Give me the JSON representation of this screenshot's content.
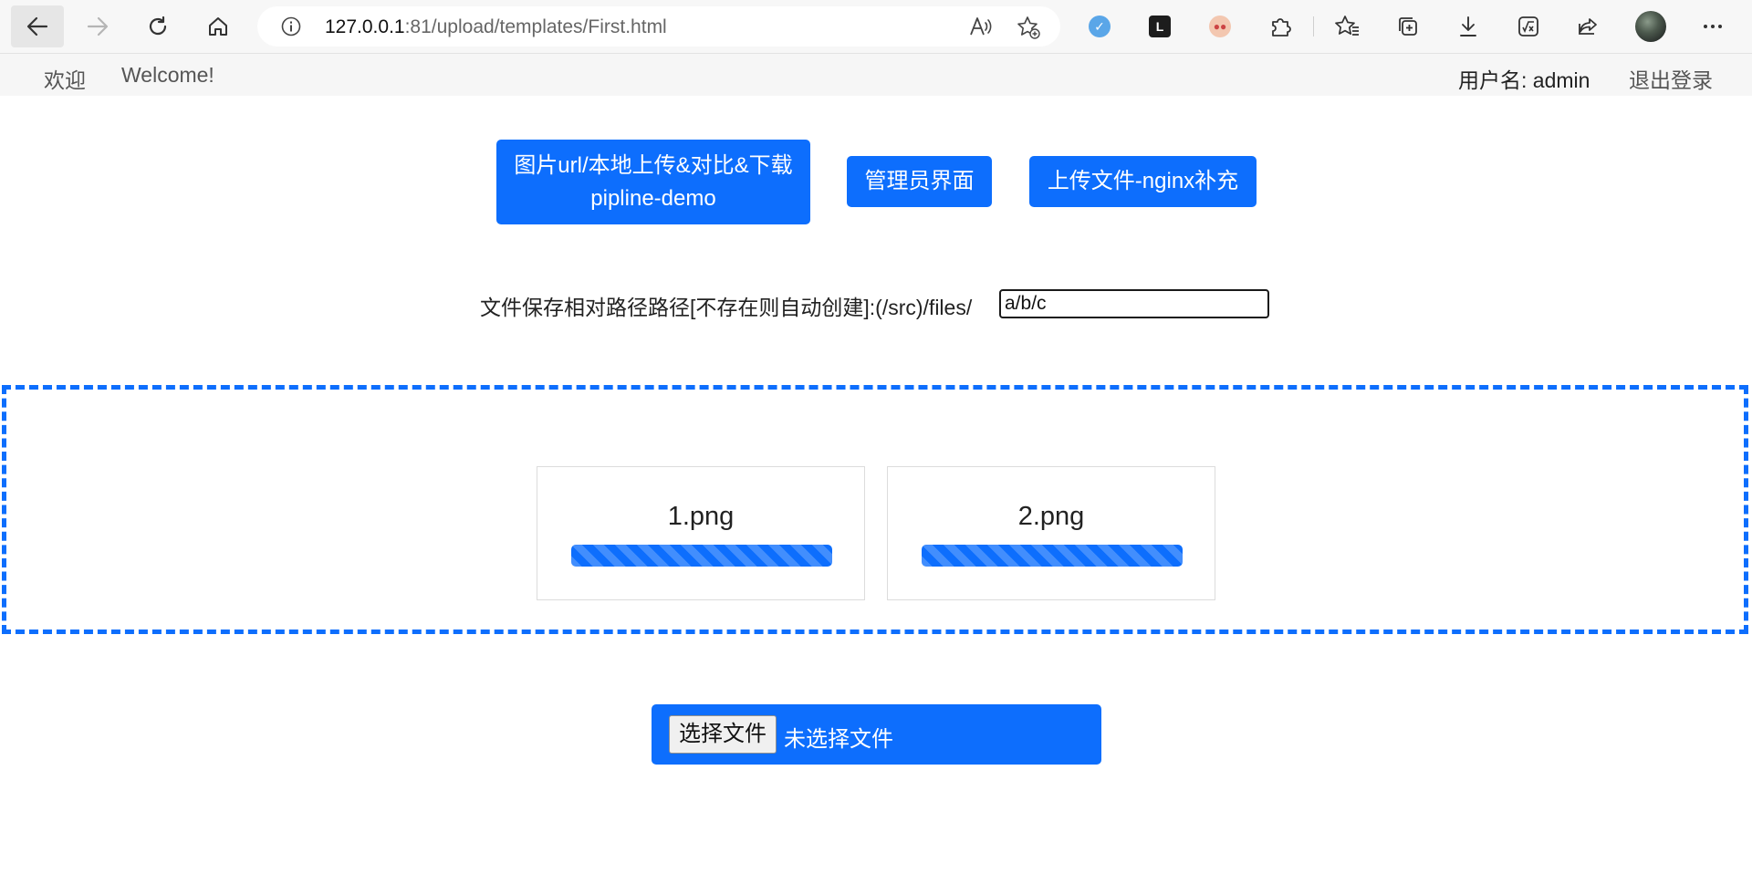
{
  "browser": {
    "url_host": "127.0.0.1",
    "url_rest": ":81/upload/templates/First.html"
  },
  "site_nav": {
    "welcome_cn": "欢迎",
    "welcome_en": "Welcome!",
    "username": "用户名: admin",
    "logout": "退出登录"
  },
  "buttons": {
    "upload_compare_line1": "图片url/本地上传&对比&下载",
    "upload_compare_line2": "pipline-demo",
    "admin": "管理员界面",
    "upload_nginx": "上传文件-nginx补充"
  },
  "path": {
    "label": "文件保存相对路径路径[不存在则自动创建]:(/src)/files/",
    "value": "a/b/c"
  },
  "uploads": [
    {
      "name": "1.png",
      "progress_percent": 100
    },
    {
      "name": "2.png",
      "progress_percent": 100
    }
  ],
  "file_picker": {
    "choose_label": "选择文件",
    "status": "未选择文件"
  },
  "colors": {
    "accent": "#0d6efd"
  }
}
